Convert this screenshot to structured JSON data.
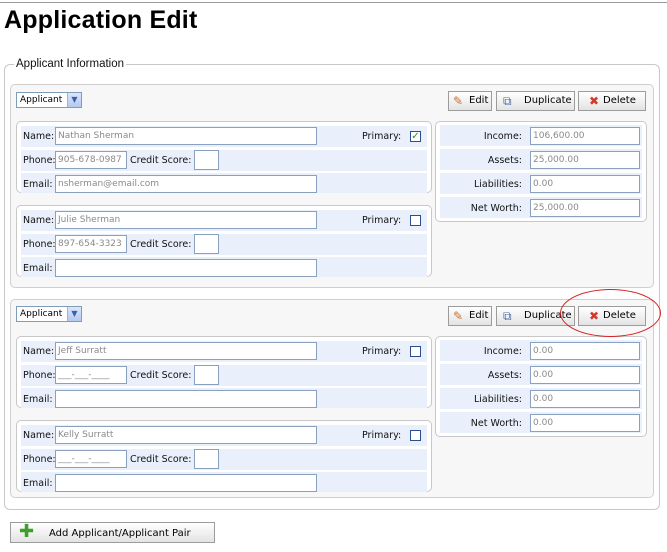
{
  "page": {
    "title": "Application Edit"
  },
  "section": {
    "legend": "Applicant Information"
  },
  "buttons": {
    "edit": "Edit",
    "duplicate": "Duplicate",
    "delete": "Delete",
    "add_pair": "Add Applicant/Applicant Pair"
  },
  "labels": {
    "name": "Name:",
    "phone": "Phone:",
    "credit_score": "Credit Score:",
    "email": "Email:",
    "primary": "Primary:",
    "income": "Income:",
    "assets": "Assets:",
    "liabilities": "Liabilities:",
    "net_worth": "Net Worth:"
  },
  "groups": [
    {
      "type": "Applicant",
      "applicants": [
        {
          "name": "Nathan Sherman",
          "phone": "905-678-0987",
          "credit_score": "",
          "email": "nsherman@email.com",
          "primary": true
        },
        {
          "name": "Julie Sherman",
          "phone": "897-654-3323",
          "credit_score": "",
          "email": "",
          "primary": false
        }
      ],
      "financials": {
        "income": "106,600.00",
        "assets": "25,000.00",
        "liabilities": "0.00",
        "net_worth": "25,000.00"
      }
    },
    {
      "type": "Applicant",
      "applicants": [
        {
          "name": "Jeff Surratt",
          "phone": "___-___-____",
          "credit_score": "",
          "email": "",
          "primary": false
        },
        {
          "name": "Kelly Surratt",
          "phone": "___-___-____",
          "credit_score": "",
          "email": "",
          "primary": false
        }
      ],
      "financials": {
        "income": "0.00",
        "assets": "0.00",
        "liabilities": "0.00",
        "net_worth": "0.00"
      }
    }
  ],
  "icons": {
    "edit": "pencil-icon",
    "duplicate": "duplicate-icon",
    "delete": "delete-x-icon",
    "add": "plus-icon",
    "dropdown": "chevron-down-icon",
    "check": "checkmark-icon"
  },
  "colors": {
    "accent_row": "#eaf0fb",
    "annotation": "#d42222",
    "check": "#27903a"
  }
}
